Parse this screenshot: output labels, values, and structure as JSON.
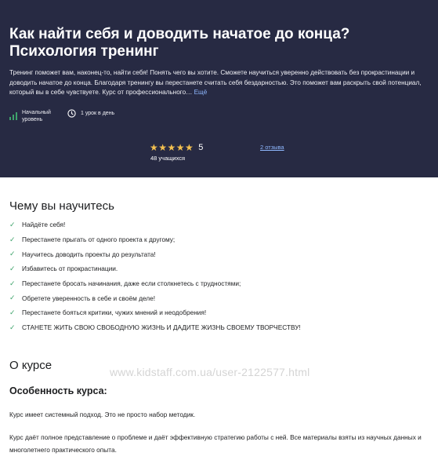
{
  "hero": {
    "title": "Как найти себя и доводить начатое до конца? Психология тренинг",
    "description": "Тренинг поможет вам, наконец-то, найти себя! Понять чего вы хотите. Сможете научиться уверенно действовать без прокрастинации и доводить начатое до конца. Благодаря тренингу вы перестанете считать себя бездарностью. Это поможет вам раскрыть свой потенциал, который вы в себе чувствуете. Курс от профессионального… ",
    "more_label": "Ещё",
    "level_label": "Начальный уровень",
    "duration_label": "1 урок в день",
    "stars": "★★★★★",
    "rating": "5",
    "students": "48 учащихся",
    "reviews_link": "2 отзыва",
    "colors": {
      "background": "#272a43",
      "star": "#f4c150",
      "link": "#8fb8ff"
    },
    "icons": [
      "bar-chart-icon",
      "clock-icon",
      "star-icon"
    ]
  },
  "learn": {
    "title": "Чему вы научитесь",
    "check_icon": "✓",
    "items": [
      "Найдёте себя!",
      "Перестанете прыгать от одного проекта к другому;",
      "Научитесь доводить проекты до результата!",
      "Избавитесь от прокрастинации.",
      "Перестанете бросать начинания, даже если столкнетесь с трудностями;",
      "Обретете уверенность в себе и своём деле!",
      "Перестанете бояться критики, чужих мнений и неодобрения!",
      "СТАНЕТЕ ЖИТЬ СВОЮ СВОБОДНУЮ ЖИЗНЬ И ДАДИТЕ ЖИЗНЬ СВОЕМУ ТВОРЧЕСТВУ!"
    ]
  },
  "about": {
    "title": "О курсе",
    "feature_title": "Особенность курса:",
    "paragraph1": "Курс имеет системный подход. Это не просто набор методик.",
    "paragraph2": "Курс даёт полное представление о проблеме и даёт эффективную стратегию работы с ней. Все материалы взяты из научных данных и многолетнего практического опыта."
  },
  "watermark": "www.kidstaff.com.ua/user-2122577.html"
}
